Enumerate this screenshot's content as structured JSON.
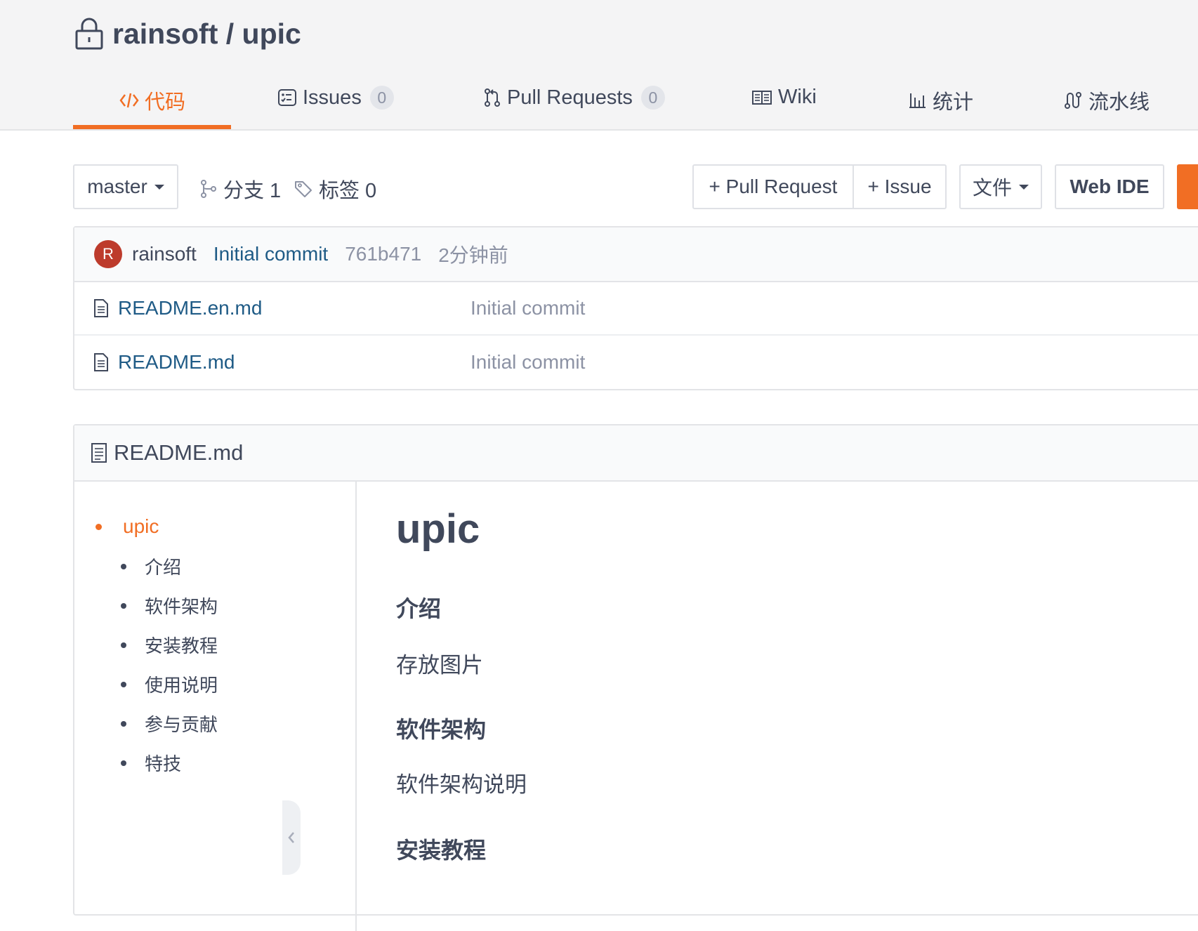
{
  "repo": {
    "owner": "rainsoft",
    "separator": " / ",
    "name": "upic"
  },
  "tabs": [
    {
      "label": "代码",
      "active": true
    },
    {
      "label": "Issues",
      "count": "0"
    },
    {
      "label": "Pull Requests",
      "count": "0"
    },
    {
      "label": "Wiki"
    },
    {
      "label": "统计"
    },
    {
      "label": "流水线"
    }
  ],
  "toolbar": {
    "branch": "master",
    "branches_label": "分支 1",
    "tags_label": "标签 0",
    "pull_request_button": "+ Pull Request",
    "issue_button": "+ Issue",
    "file_button": "文件",
    "web_ide_button": "Web IDE"
  },
  "commit": {
    "avatar_letter": "R",
    "author": "rainsoft",
    "message": "Initial commit",
    "hash": "761b471",
    "time": "2分钟前"
  },
  "files": [
    {
      "name": "README.en.md",
      "commit": "Initial commit"
    },
    {
      "name": "README.md",
      "commit": "Initial commit"
    }
  ],
  "readme": {
    "title": "README.md",
    "toc": {
      "top": "upic",
      "items": [
        "介绍",
        "软件架构",
        "安装教程",
        "使用说明",
        "参与贡献",
        "特技"
      ]
    },
    "content": {
      "h1": "upic",
      "sections": [
        {
          "heading": "介绍",
          "text": "存放图片"
        },
        {
          "heading": "软件架构",
          "text": "软件架构说明"
        },
        {
          "heading": "安装教程"
        }
      ]
    }
  },
  "colors": {
    "accent": "#f16e24",
    "link": "#1f5b86",
    "muted": "#8c92a4",
    "avatar": "#bd3b2c"
  }
}
